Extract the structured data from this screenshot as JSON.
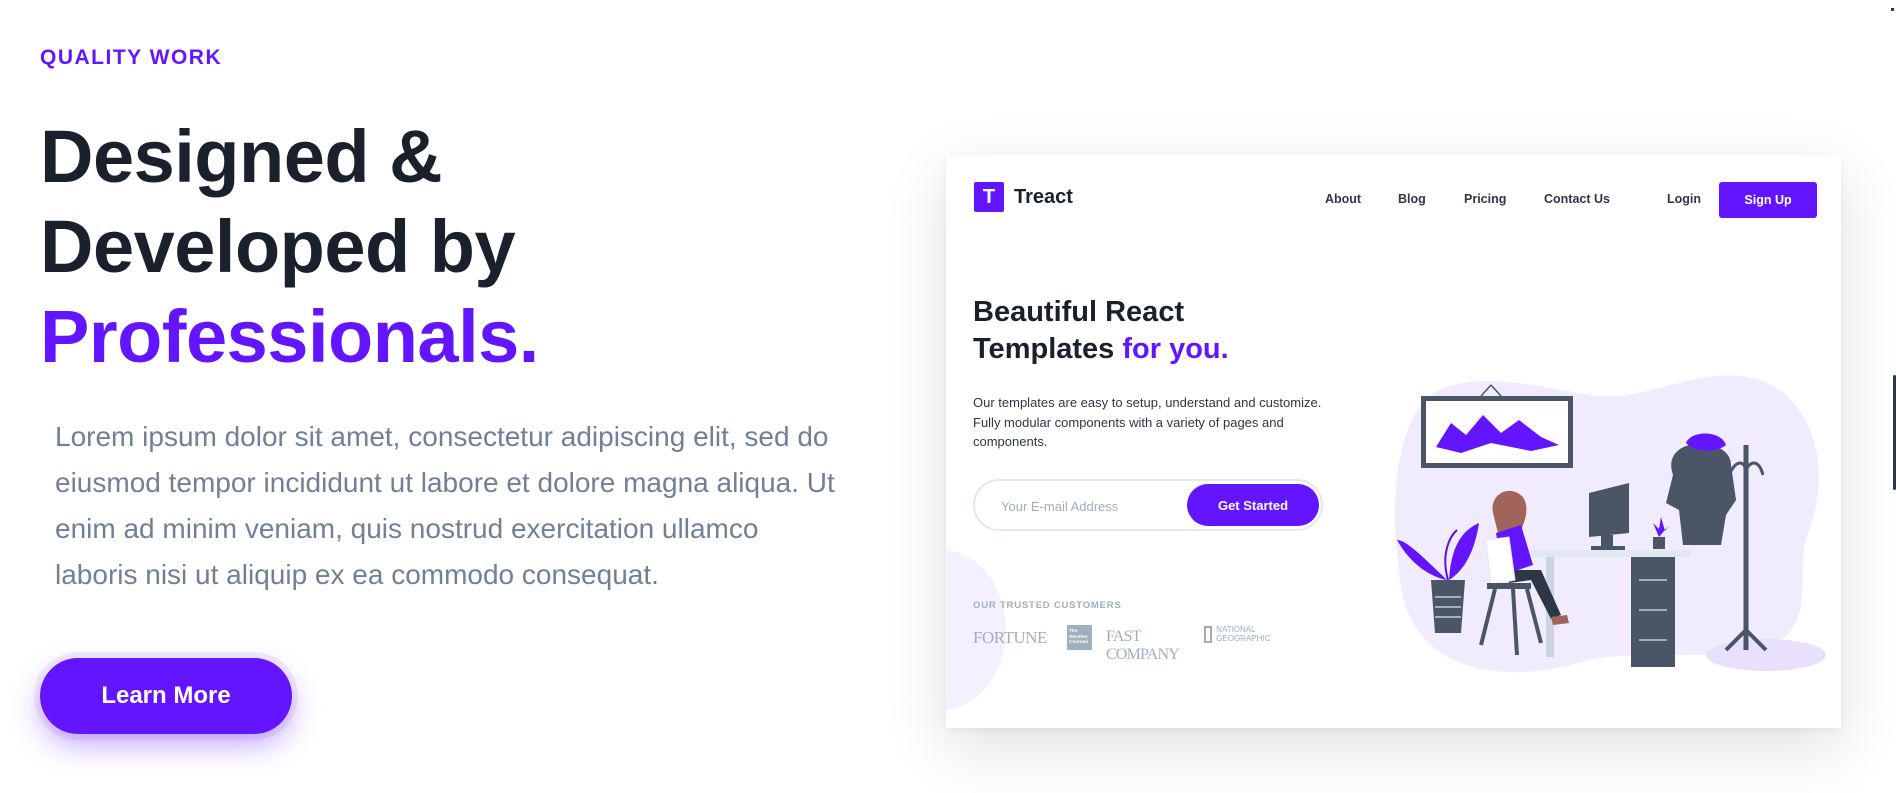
{
  "hero": {
    "eyebrow": "QUALITY WORK",
    "heading_line1": "Designed &",
    "heading_line2": "Developed by",
    "heading_accent": "Professionals.",
    "description": "Lorem ipsum dolor sit amet, consectetur adipiscing elit, sed do eiusmod tempor incididunt ut labore et dolore magna aliqua. Ut enim ad minim veniam, quis nostrud exercitation ullamco laboris nisi ut aliquip ex ea commodo consequat.",
    "cta_label": "Learn More"
  },
  "preview": {
    "logo_text": "Treact",
    "logo_letter": "T",
    "nav": [
      "About",
      "Blog",
      "Pricing",
      "Contact Us"
    ],
    "login_label": "Login",
    "signup_label": "Sign Up",
    "heading_line1": "Beautiful React",
    "heading_line2": "Templates",
    "heading_accent": "for you.",
    "description": "Our templates are easy to setup, understand and customize. Fully modular components with a variety of pages and components.",
    "email_placeholder": "Your E-mail Address",
    "cta_label": "Get Started",
    "trusted_label": "OUR TRUSTED CUSTOMERS",
    "logos": {
      "fortune": "FORTUNE",
      "weather_channel": "The Weather Channel",
      "fast_company": "FAST COMPANY",
      "national_geographic": "NATIONAL GEOGRAPHIC"
    }
  },
  "colors": {
    "accent": "#6415ff",
    "heading": "#1a202c",
    "body_text": "#718096",
    "logo_gray": "#a0aec0"
  }
}
